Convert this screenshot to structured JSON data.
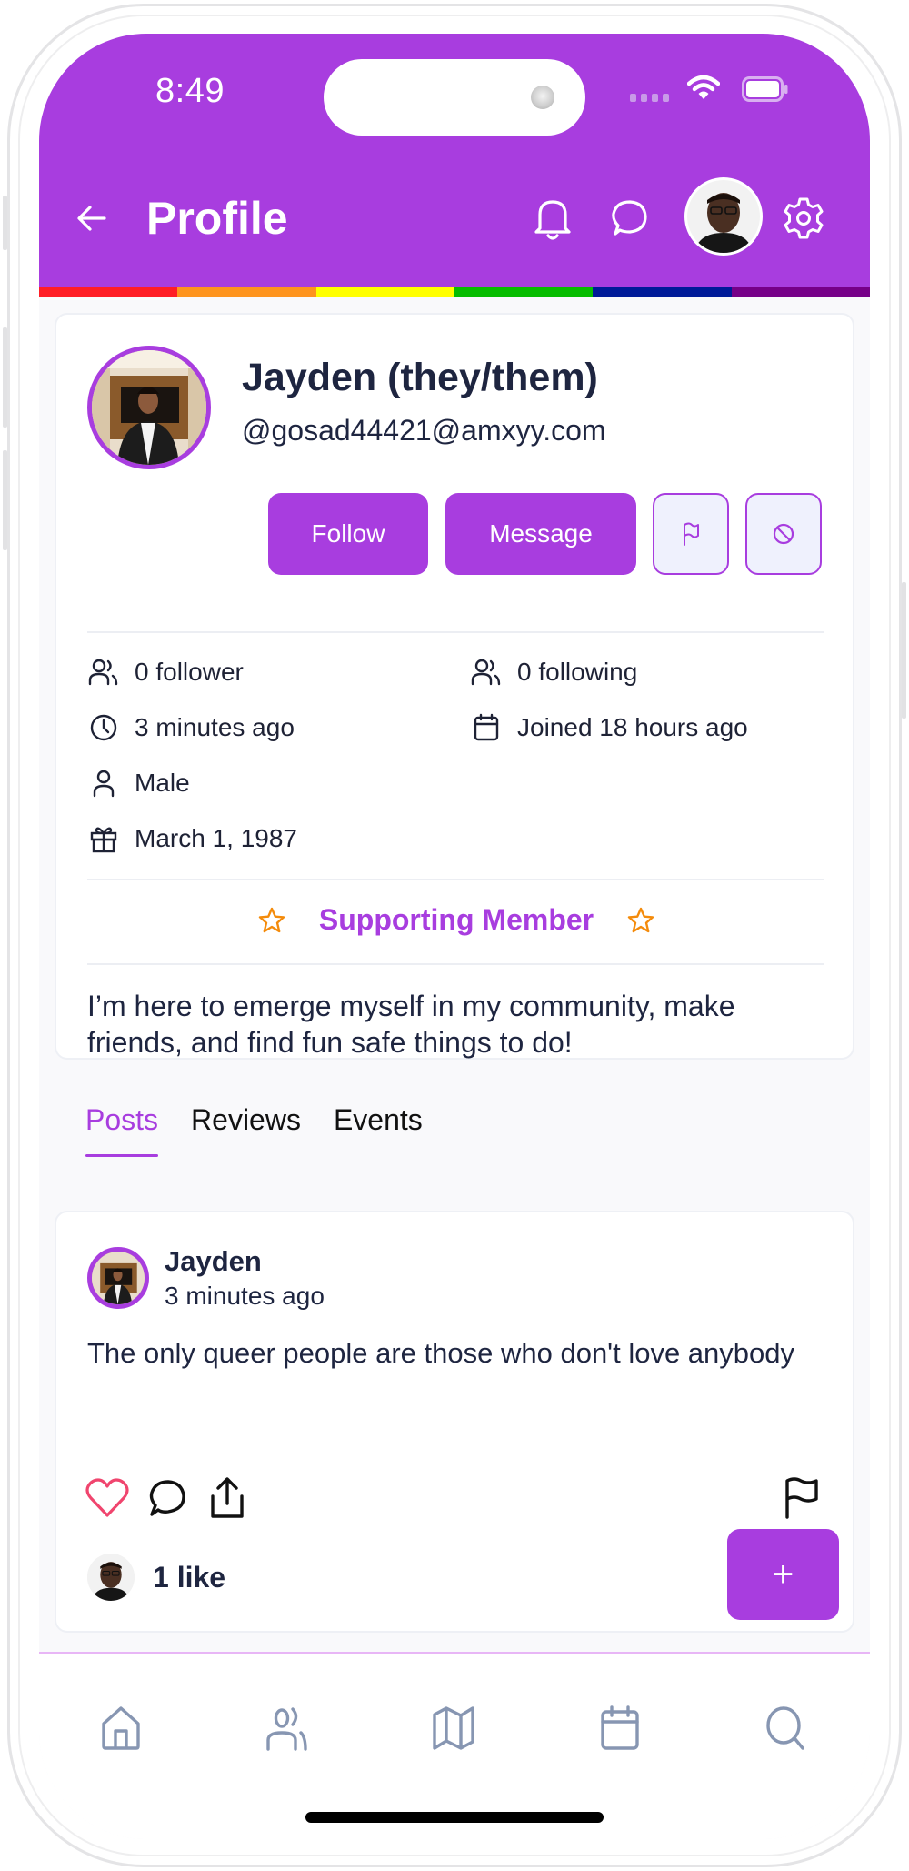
{
  "status_bar": {
    "time": "8:49"
  },
  "header": {
    "title": "Profile",
    "icons": [
      "back-arrow-icon",
      "bell-icon",
      "chat-bubble-icon",
      "user-avatar",
      "gear-icon"
    ]
  },
  "theme": {
    "accent": "#a83ddf",
    "rainbow": [
      "#ff1e26",
      "#fe941e",
      "#ffff00",
      "#06bd00",
      "#001a98",
      "#760088"
    ],
    "star_color": "#f48b0b",
    "heart_color": "#f0456e",
    "nav_icon_color": "#8796b2"
  },
  "profile": {
    "name": "Jayden (they/them)",
    "handle": "@gosad44421@amxyy.com",
    "actions": {
      "follow": "Follow",
      "message": "Message",
      "report_icon": "flag-icon",
      "block_icon": "block-icon"
    },
    "stats": {
      "followers": "0 follower",
      "following": "0 following",
      "last_active": "3 minutes ago",
      "joined": "Joined 18 hours ago",
      "gender": "Male",
      "birthday": "March 1, 1987"
    },
    "badge": "Supporting Member",
    "bio": "I’m here to emerge myself in my community, make friends, and find fun safe things to do!"
  },
  "tabs": [
    {
      "label": "Posts",
      "active": true
    },
    {
      "label": "Reviews",
      "active": false
    },
    {
      "label": "Events",
      "active": false
    }
  ],
  "posts": [
    {
      "author": "Jayden",
      "time": "3 minutes ago",
      "text": "The only queer people are those who don't love anybody",
      "likes": "1 like"
    }
  ],
  "fab": {
    "label": "+"
  },
  "bottom_nav": [
    {
      "icon": "home-icon"
    },
    {
      "icon": "users-icon"
    },
    {
      "icon": "map-icon"
    },
    {
      "icon": "calendar-icon"
    },
    {
      "icon": "search-icon"
    }
  ]
}
